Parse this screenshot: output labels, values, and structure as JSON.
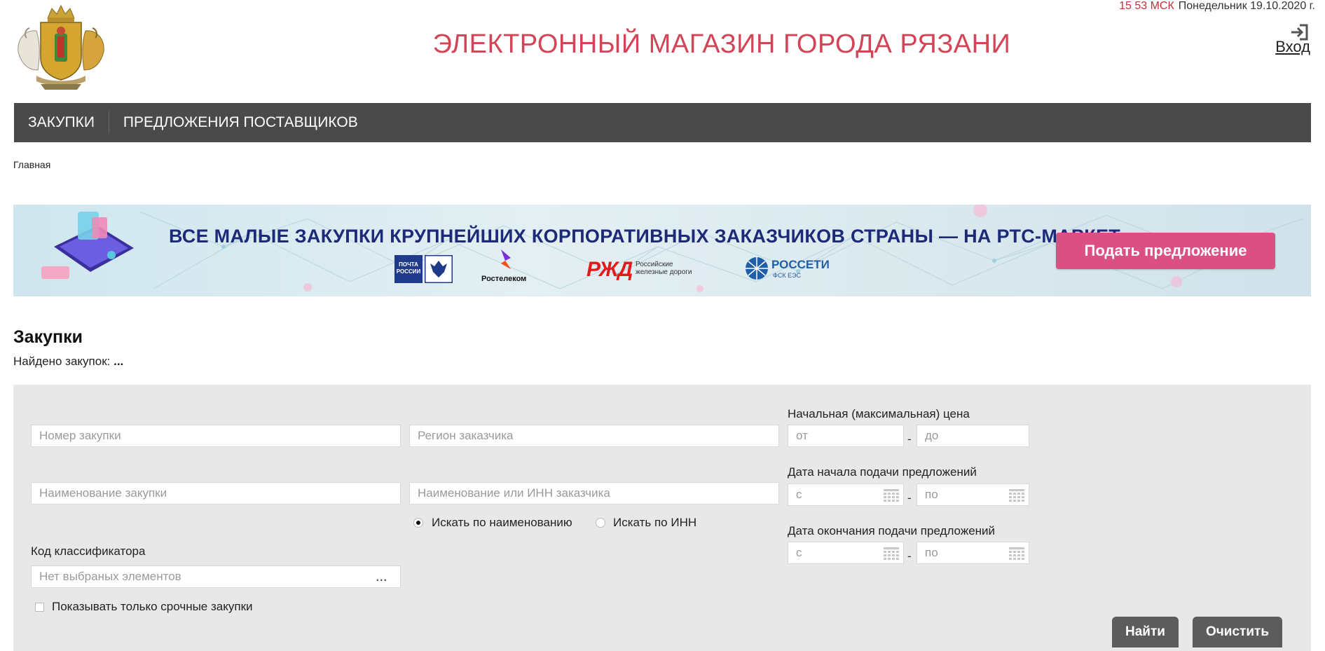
{
  "header": {
    "time": "15 53 МСК",
    "date": "Понедельник 19.10.2020 г.",
    "title": "ЭЛЕКТРОННЫЙ МАГАЗИН ГОРОДА РЯЗАНИ",
    "login_label": "Вход",
    "colors": {
      "title": "#d24456",
      "clock": "#c9303a"
    }
  },
  "nav": {
    "items": [
      {
        "label": "ЗАКУПКИ"
      },
      {
        "label": "ПРЕДЛОЖЕНИЯ ПОСТАВЩИКОВ"
      }
    ],
    "background": "#4a4a4a"
  },
  "breadcrumb": {
    "home": "Главная"
  },
  "banner": {
    "text": "ВСЕ МАЛЫЕ ЗАКУПКИ КРУПНЕЙШИХ КОРПОРАТИВНЫХ ЗАКАЗЧИКОВ СТРАНЫ — НА РТС-МАРКЕТ",
    "button_label": "Подать предложение",
    "logos": {
      "pochta": "ПОЧТА РОССИИ",
      "rostelecom": "Ростелеком",
      "rzd": "РЖД",
      "rzd_caption_1": "Российские",
      "rzd_caption_2": "железные дороги",
      "rosseti": "РОССЕТИ",
      "rosseti_sub": "ФСК ЕЭС"
    },
    "button_color": "#dc4f83"
  },
  "section": {
    "title": "Закупки",
    "found_label": "Найдено закупок:",
    "found_value": "..."
  },
  "filters": {
    "purchase_number_placeholder": "Номер закупки",
    "customer_region_placeholder": "Регион заказчика",
    "purchase_name_placeholder": "Наименование закупки",
    "customer_name_placeholder": "Наименование или ИНН заказчика",
    "search_by_name_label": "Искать по наименованию",
    "search_by_inn_label": "Искать по ИНН",
    "search_mode_selected": "name",
    "classifier_label": "Код классификатора",
    "classifier_placeholder": "Нет выбраных элементов",
    "classifier_more": "...",
    "urgent_only_label": "Показывать только срочные закупки",
    "urgent_only_checked": false,
    "price_label": "Начальная (максимальная) цена",
    "price_from_placeholder": "от",
    "price_to_placeholder": "до",
    "start_date_label": "Дата начала подачи предложений",
    "end_date_label": "Дата окончания подачи предложений",
    "date_from_placeholder": "с",
    "date_to_placeholder": "по",
    "range_separator": "-",
    "search_button": "Найти",
    "clear_button": "Очистить"
  }
}
